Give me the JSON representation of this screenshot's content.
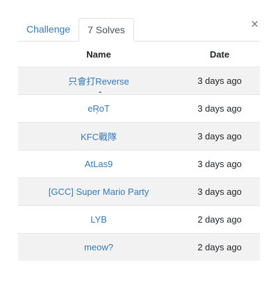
{
  "modal": {
    "close_glyph": "×"
  },
  "tabs": [
    {
      "label": "Challenge"
    },
    {
      "label": "7 Solves"
    }
  ],
  "table": {
    "headers": {
      "name": "Name",
      "date": "Date"
    },
    "rows": [
      {
        "name": "只會打Reverse",
        "date": "3 days ago"
      },
      {
        "name": "eRoT",
        "date": "3 days ago"
      },
      {
        "name": "KFC戰隊",
        "date": "3 days ago"
      },
      {
        "name": "AtLas9",
        "date": "3 days ago"
      },
      {
        "name": "[GCC] Super Mario Party",
        "date": "3 days ago"
      },
      {
        "name": "LYB",
        "date": "2 days ago"
      },
      {
        "name": "meow?",
        "date": "2 days ago"
      }
    ]
  },
  "colors": {
    "link": "#337ab7",
    "stripe": "#f2f2f2",
    "border": "#dee2e6"
  }
}
